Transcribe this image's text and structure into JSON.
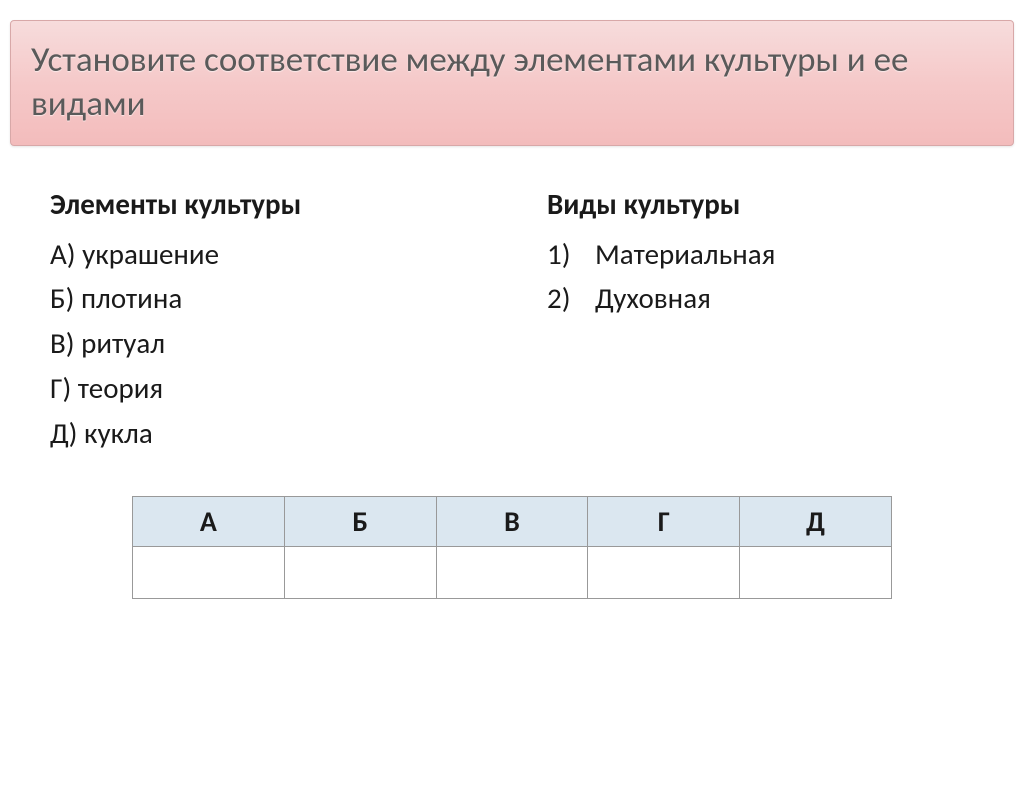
{
  "title": "Установите соответствие между элементами культуры и ее видами",
  "left": {
    "heading": "Элементы культуры",
    "items": [
      "А) украшение",
      "Б) плотина",
      "В) ритуал",
      "Г) теория",
      "Д) кукла"
    ]
  },
  "right": {
    "heading": "Виды культуры",
    "items": [
      {
        "num": "1)",
        "text": "Материальная"
      },
      {
        "num": "2)",
        "text": "Духовная"
      }
    ]
  },
  "table": {
    "headers": [
      "А",
      "Б",
      "В",
      "Г",
      "Д"
    ],
    "answers": [
      "",
      "",
      "",
      "",
      ""
    ]
  }
}
